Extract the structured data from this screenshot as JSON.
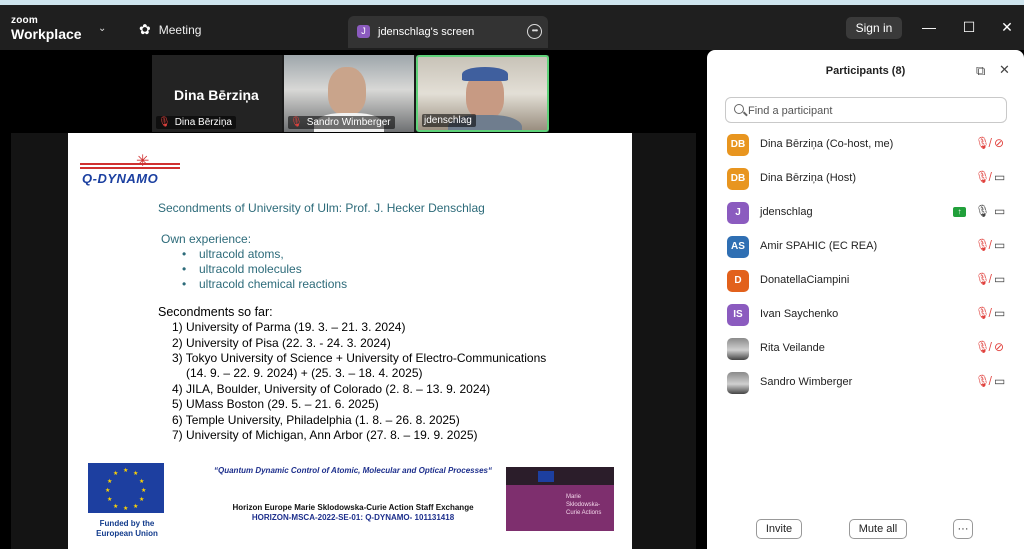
{
  "app": {
    "brand_small": "zoom",
    "brand_big": "Workplace",
    "meeting_label": "Meeting",
    "share_tab_initial": "J",
    "share_tab_label": "jdenschlag's screen",
    "sign_in": "Sign in"
  },
  "video_tiles": [
    {
      "name": "Dina Bērziņa",
      "display_name": "Dina Bērziņa",
      "muted": true
    },
    {
      "name": "Sandro Wimberger",
      "muted": true
    },
    {
      "name": "jdenschlag",
      "muted": false,
      "active_speaker": true
    }
  ],
  "slide": {
    "logo_text": "Q-DYNAMO",
    "heading": "Secondments of University of Ulm: Prof. J. Hecker Denschlag",
    "own_experience_label": "Own experience:",
    "own_experience": [
      "ultracold atoms,",
      "ultracold molecules",
      "ultracold chemical reactions"
    ],
    "secondments_label": "Secondments so far:",
    "secondments": [
      "1) University of Parma (19. 3. – 21. 3. 2024)",
      "2) University of Pisa     (22. 3. -  24. 3. 2024)",
      "3) Tokyo University of Science +  University of Electro-Communications",
      "(14. 9. – 22. 9. 2024) + (25. 3. – 18. 4. 2025)",
      "4) JILA, Boulder, University of Colorado (2. 8. – 13. 9. 2024)",
      "5) UMass Boston (29. 5. – 21. 6. 2025)",
      "6) Temple University, Philadelphia  (1. 8. – 26. 8. 2025)",
      "7)  University of Michigan, Ann Arbor  (27. 8. – 19. 9. 2025)"
    ],
    "funded_by": "Funded by the European Union",
    "project_title": "“Quantum Dynamic Control of Atomic, Molecular and Optical Processes“",
    "horizon_line": "Horizon Europe Marie Sklodowska-Curie Action Staff Exchange",
    "grant_line": "HORIZON-MSCA-2022-SE-01: Q-DYNAMO- 101131418",
    "msca_text": "Marie Skłodowska-Curie Actions"
  },
  "participants_panel": {
    "title": "Participants (8)",
    "search_placeholder": "Find a participant",
    "participants": [
      {
        "initials": "DB",
        "name": "Dina Bērziņa (Co-host, me)",
        "color": "#e8951f",
        "mic": "muted",
        "cam": "off"
      },
      {
        "initials": "DB",
        "name": "Dina Bērziņa (Host)",
        "color": "#e8951f",
        "mic": "muted",
        "cam": "on"
      },
      {
        "initials": "J",
        "name": "jdenschlag",
        "color": "#8b5bbf",
        "mic": "on",
        "cam": "on",
        "sharing": true
      },
      {
        "initials": "AS",
        "name": "Amir SPAHIC (EC REA)",
        "color": "#2f6fb3",
        "mic": "muted",
        "cam": "on"
      },
      {
        "initials": "D",
        "name": "DonatellaCiampini",
        "color": "#e2611c",
        "mic": "muted",
        "cam": "on"
      },
      {
        "initials": "IS",
        "name": "Ivan Saychenko",
        "color": "#8b5bbf",
        "mic": "muted",
        "cam": "on"
      },
      {
        "initials": "",
        "name": "Rita Veilande",
        "color": "photo",
        "mic": "muted",
        "cam": "off"
      },
      {
        "initials": "",
        "name": "Sandro Wimberger",
        "color": "photo",
        "mic": "muted",
        "cam": "on"
      }
    ],
    "invite_label": "Invite",
    "mute_all_label": "Mute all",
    "more_label": "···"
  }
}
